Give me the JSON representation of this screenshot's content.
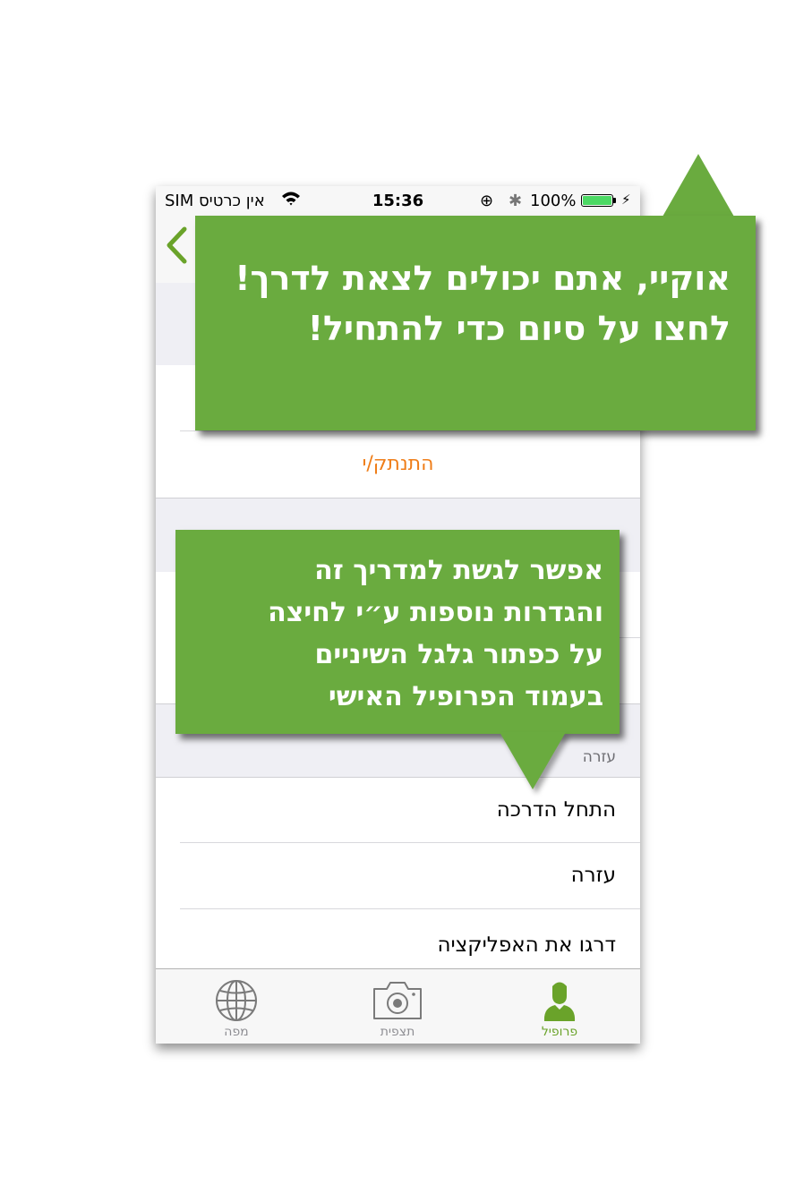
{
  "status_bar": {
    "carrier": "SIM אין כרטיס",
    "time": "15:36",
    "battery_percent": "100%",
    "battery_level": 1.0
  },
  "nav": {
    "back_icon": "chevron-left-icon"
  },
  "settings": {
    "logout_label": "התנתק/י",
    "help_section_title": "עזרה",
    "help_rows": [
      {
        "label": "התחל הדרכה"
      },
      {
        "label": "עזרה"
      },
      {
        "label": "דרגו את האפליקציה"
      }
    ]
  },
  "tabbar": {
    "tabs": [
      {
        "label": "מפה",
        "icon": "globe-icon",
        "active": false
      },
      {
        "label": "תצפית",
        "icon": "camera-icon",
        "active": false
      },
      {
        "label": "פרופיל",
        "icon": "person-icon",
        "active": true
      }
    ]
  },
  "tutorial": {
    "top_bubble_text": "אוקיי, אתם יכולים לצאת לדרך!\nלחצו על סיום כדי להתחיל!",
    "bottom_bubble_text": "אפשר לגשת למדריך זה\nוהגדרות נוספות ע״י לחיצה\nעל כפתור גלגל השיניים\nבעמוד הפרופיל האישי"
  },
  "colors": {
    "accent_green": "#6aa32a",
    "bubble_green": "#6aab3f",
    "logout_orange": "#ef7d18",
    "battery_green": "#4cd964"
  }
}
